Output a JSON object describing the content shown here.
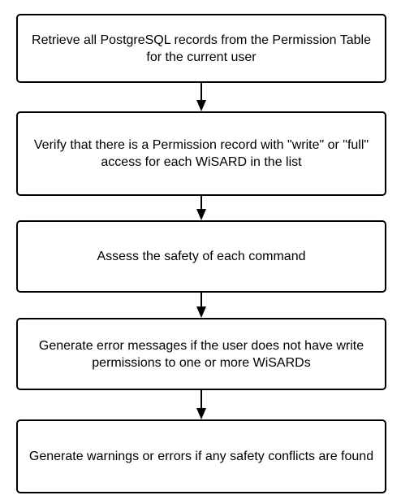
{
  "diagram": {
    "steps": [
      {
        "text": "Retrieve all PostgreSQL records from the Permission Table for the current user"
      },
      {
        "text": "Verify that there is a Permission record with \"write\" or \"full\" access for each WiSARD in the list"
      },
      {
        "text": "Assess the safety of each command"
      },
      {
        "text": "Generate error messages if the user does not have write permissions to one or more WiSARDs"
      },
      {
        "text": "Generate warnings or errors if any safety conflicts are found"
      }
    ],
    "colors": {
      "stroke": "#000000",
      "fill": "#ffffff",
      "text": "#000000"
    }
  }
}
